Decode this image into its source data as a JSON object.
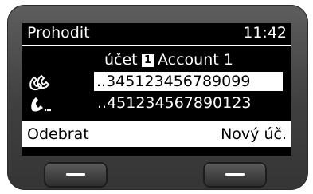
{
  "header": {
    "title": "Prohodit",
    "time": "11:42"
  },
  "account": {
    "label": "účet",
    "number": "1",
    "name": "Account 1"
  },
  "numbers": [
    {
      "icon": "multi-line-icon",
      "value": "..345123456789099"
    },
    {
      "icon": "handset-icon",
      "value": "..451234567890123"
    }
  ],
  "softkeys": {
    "left": "Odebrat",
    "right": "Nový úč."
  },
  "colors": {
    "screen_bg": "#000000",
    "text": "#ffffff",
    "highlight": "#ffffff",
    "device": "#4a4a4a"
  }
}
